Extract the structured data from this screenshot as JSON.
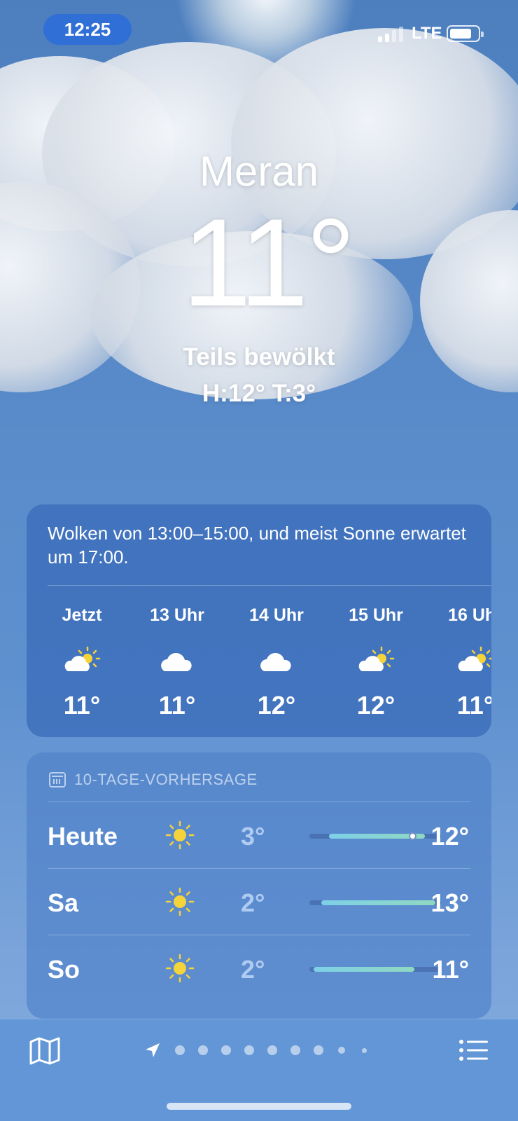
{
  "status_bar": {
    "time": "12:25",
    "network": "LTE",
    "icons": [
      "signal-icon",
      "battery-icon"
    ]
  },
  "header": {
    "city": "Meran",
    "temperature": "11°",
    "condition": "Teils bewölkt",
    "high_low": "H:12°  T:3°"
  },
  "hourly": {
    "summary": "Wolken von 13:00–15:00, und meist Sonne erwartet um 17:00.",
    "hours": [
      {
        "label": "Jetzt",
        "icon": "partly-sunny-icon",
        "temp": "11°"
      },
      {
        "label": "13 Uhr",
        "icon": "cloud-icon",
        "temp": "11°"
      },
      {
        "label": "14 Uhr",
        "icon": "cloud-icon",
        "temp": "12°"
      },
      {
        "label": "15 Uhr",
        "icon": "partly-sunny-icon",
        "temp": "12°"
      },
      {
        "label": "16 Uhr",
        "icon": "partly-sunny-icon",
        "temp": "11°"
      }
    ]
  },
  "forecast": {
    "title": "10-TAGE-VORHERSAGE",
    "days": [
      {
        "name": "Heute",
        "icon": "sun-icon",
        "low": "3°",
        "high": "12°",
        "range_start": 0.15,
        "range_end": 0.88,
        "current_marker": 0.78
      },
      {
        "name": "Sa",
        "icon": "sun-icon",
        "low": "2°",
        "high": "13°",
        "range_start": 0.09,
        "range_end": 0.96
      },
      {
        "name": "So",
        "icon": "sun-icon",
        "low": "2°",
        "high": "11°",
        "range_start": 0.03,
        "range_end": 0.8
      }
    ]
  },
  "bottom_bar": {
    "icons": [
      "map-icon",
      "location-arrow-icon",
      "list-icon"
    ]
  },
  "colors": {
    "accent": "#2f6fd6",
    "sun": "#f5d33a",
    "bar_start": "#7ed0e8",
    "bar_end": "#8fd8c0"
  }
}
